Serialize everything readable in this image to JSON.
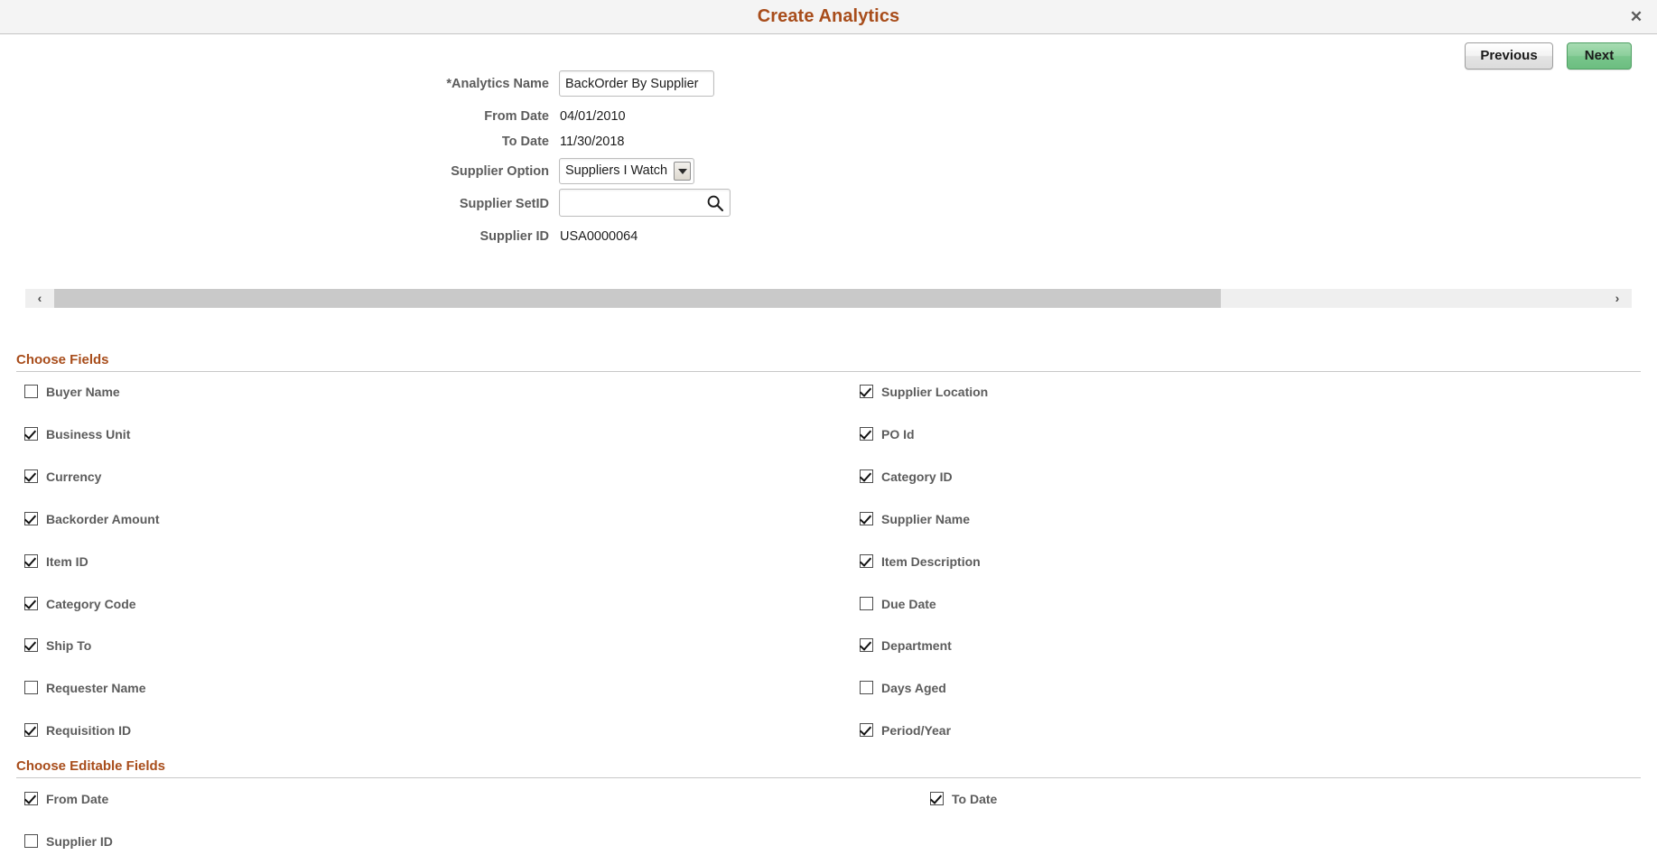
{
  "window": {
    "title": "Create Analytics",
    "close_label": "✕"
  },
  "toolbar": {
    "previous_label": "Previous",
    "next_label": "Next"
  },
  "form": {
    "analytics_name": {
      "label": "*Analytics Name",
      "value": "BackOrder By Supplier",
      "placeholder": ""
    },
    "from_date": {
      "label": "From Date",
      "value": "04/01/2010"
    },
    "to_date": {
      "label": "To Date",
      "value": "11/30/2018"
    },
    "supplier_option": {
      "label": "Supplier Option",
      "value": "Suppliers I Watch",
      "options": [
        "Suppliers I Watch"
      ]
    },
    "supplier_setid": {
      "label": "Supplier SetID",
      "value": "",
      "placeholder": ""
    },
    "supplier_id": {
      "label": "Supplier ID",
      "value": "USA0000064"
    }
  },
  "scrollbar": {
    "left_arrow": "‹",
    "right_arrow": "›"
  },
  "choose_fields": {
    "heading": "Choose Fields",
    "left_column": [
      {
        "label": "Buyer Name",
        "checked": false
      },
      {
        "label": "Business Unit",
        "checked": true
      },
      {
        "label": "Currency",
        "checked": true
      },
      {
        "label": "Backorder Amount",
        "checked": true
      },
      {
        "label": "Item ID",
        "checked": true
      },
      {
        "label": "Category Code",
        "checked": true
      },
      {
        "label": "Ship To",
        "checked": true
      },
      {
        "label": "Requester Name",
        "checked": false
      },
      {
        "label": "Requisition ID",
        "checked": true
      }
    ],
    "right_column": [
      {
        "label": "Supplier Location",
        "checked": true
      },
      {
        "label": "PO Id",
        "checked": true
      },
      {
        "label": "Category ID",
        "checked": true
      },
      {
        "label": "Supplier Name",
        "checked": true
      },
      {
        "label": "Item Description",
        "checked": true
      },
      {
        "label": "Due Date",
        "checked": false
      },
      {
        "label": "Department",
        "checked": true
      },
      {
        "label": "Days Aged",
        "checked": false
      },
      {
        "label": "Period/Year",
        "checked": true
      }
    ]
  },
  "choose_editable_fields": {
    "heading": "Choose Editable Fields",
    "left_column": [
      {
        "label": "From Date",
        "checked": true
      },
      {
        "label": "Supplier ID",
        "checked": false
      }
    ],
    "right_column": [
      {
        "label": "To Date",
        "checked": true
      }
    ]
  },
  "colors": {
    "accent": "#a84d1b",
    "next_button": "#79c68c",
    "header_bg": "#f4f4f4"
  }
}
